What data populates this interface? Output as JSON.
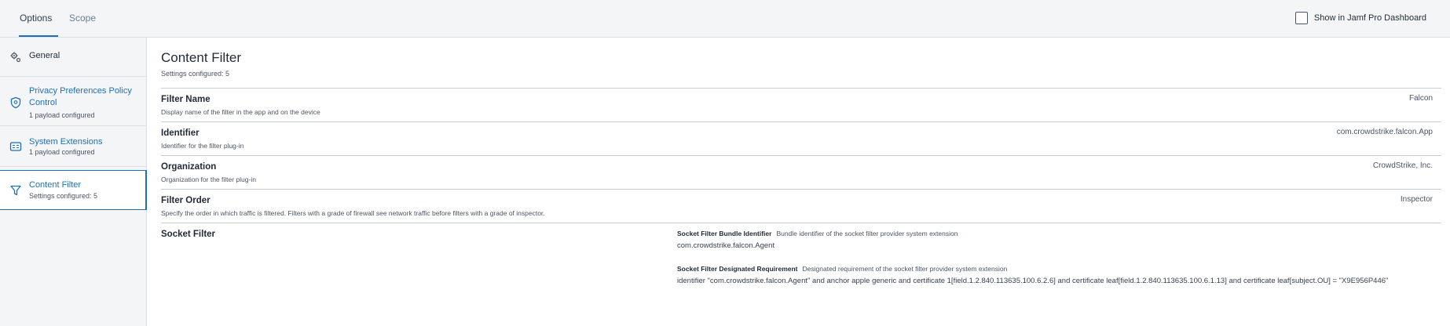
{
  "tabs": {
    "options": "Options",
    "scope": "Scope"
  },
  "dashboard": {
    "label": "Show in Jamf Pro Dashboard"
  },
  "sidebar": {
    "items": [
      {
        "label": "General",
        "sub": "",
        "icon": "gear-icon"
      },
      {
        "label": "Privacy Preferences Policy Control",
        "sub": "1 payload configured",
        "icon": "shield-icon"
      },
      {
        "label": "System Extensions",
        "sub": "1 payload configured",
        "icon": "extension-icon"
      },
      {
        "label": "Content Filter",
        "sub": "Settings configured: 5",
        "icon": "filter-icon"
      }
    ]
  },
  "main": {
    "title": "Content Filter",
    "subtitle": "Settings configured: 5",
    "fields": [
      {
        "name": "Filter Name",
        "desc": "Display name of the filter in the app and on the device",
        "value": "Falcon"
      },
      {
        "name": "Identifier",
        "desc": "Identifier for the filter plug-in",
        "value": "com.crowdstrike.falcon.App"
      },
      {
        "name": "Organization",
        "desc": "Organization for the filter plug-in",
        "value": "CrowdStrike, Inc."
      },
      {
        "name": "Filter Order",
        "desc": "Specify the order in which traffic is filtered. Filters with a grade of firewall see network traffic before filters with a grade of inspector.",
        "value": "Inspector"
      }
    ],
    "socket": {
      "name": "Socket Filter",
      "bundle_title": "Socket Filter Bundle Identifier",
      "bundle_desc": "Bundle identifier of the socket filter provider system extension",
      "bundle_value": "com.crowdstrike.falcon.Agent",
      "req_title": "Socket Filter Designated Requirement",
      "req_desc": "Designated requirement of the socket filter provider system extension",
      "req_value": "identifier \"com.crowdstrike.falcon.Agent\" and anchor apple generic and certificate 1[field.1.2.840.113635.100.6.2.6] and certificate leaf[field.1.2.840.113635.100.6.1.13] and certificate leaf[subject.OU] = \"X9E956P446\""
    }
  }
}
